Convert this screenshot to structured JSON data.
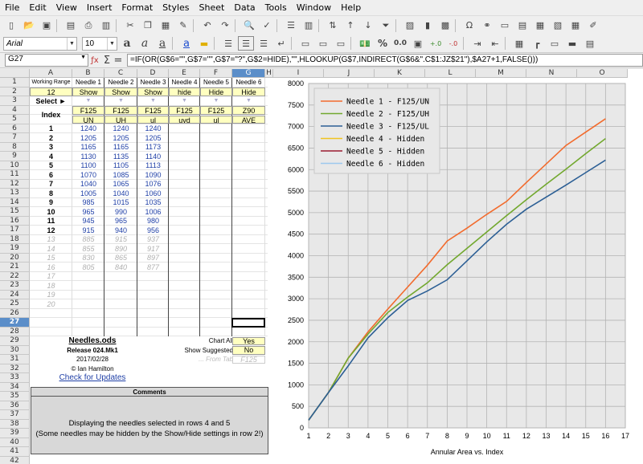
{
  "menu": [
    "File",
    "Edit",
    "View",
    "Insert",
    "Format",
    "Styles",
    "Sheet",
    "Data",
    "Tools",
    "Window",
    "Help"
  ],
  "font_name": "Arial",
  "font_size": "10",
  "namebox": "G27",
  "formula": "=IF(OR(G$6=\"\",G$7=\"\",G$7=\"?\",G$2=HIDE),\"\",HLOOKUP(G$7,INDIRECT(G$6&\".C$1:JZ$21\"),$A27+1,FALSE()))",
  "columns": [
    "A",
    "B",
    "C",
    "D",
    "E",
    "F",
    "G",
    "H",
    "I",
    "J",
    "K",
    "L",
    "M",
    "N",
    "O"
  ],
  "rows": [
    "1",
    "2",
    "3",
    "4",
    "5",
    "6",
    "7",
    "8",
    "9",
    "10",
    "11",
    "12",
    "13",
    "14",
    "15",
    "16",
    "17",
    "18",
    "19",
    "20",
    "21",
    "22",
    "23",
    "24",
    "25",
    "26",
    "27",
    "28",
    "29",
    "30",
    "31",
    "32",
    "33",
    "34",
    "35",
    "36",
    "37",
    "38",
    "39",
    "40",
    "41",
    "42"
  ],
  "sheet": {
    "a1": "Working Range",
    "a2": "12",
    "a3": "Select ►",
    "a4": "Index",
    "needle_headers": [
      "Needle 1",
      "Needle 2",
      "Needle 3",
      "Needle 4",
      "Needle 5",
      "Needle 6"
    ],
    "showhide": [
      "Show",
      "Show",
      "Show",
      "hide",
      "Hide",
      "Hide"
    ],
    "arrow": "▼",
    "row4": [
      "F125",
      "F125",
      "F125",
      "F125",
      "F125",
      "Z90"
    ],
    "row5": [
      "UN",
      "UH",
      "ul",
      "uyd",
      "ul",
      "AVE"
    ],
    "index": [
      "1",
      "2",
      "3",
      "4",
      "5",
      "6",
      "7",
      "8",
      "9",
      "10",
      "11",
      "12",
      "13",
      "14",
      "15",
      "16",
      "17",
      "18",
      "19",
      "20"
    ],
    "col_b": [
      "1240",
      "1205",
      "1165",
      "1130",
      "1100",
      "1070",
      "1040",
      "1005",
      "985",
      "965",
      "945",
      "915",
      "885",
      "855",
      "830",
      "805"
    ],
    "col_c": [
      "1240",
      "1205",
      "1165",
      "1135",
      "1105",
      "1085",
      "1065",
      "1040",
      "1015",
      "990",
      "965",
      "940",
      "915",
      "890",
      "865",
      "840"
    ],
    "col_d": [
      "1240",
      "1205",
      "1173",
      "1140",
      "1113",
      "1090",
      "1076",
      "1060",
      "1035",
      "1006",
      "980",
      "956",
      "937",
      "917",
      "897",
      "877"
    ],
    "title": "Needles.ods",
    "release": "Release 024.Mk1",
    "date": "2017/02/28",
    "author": "© Ian Hamilton",
    "update_link": "Check for Updates",
    "chart_all_label": "Chart All",
    "chart_all": "Yes",
    "show_sugg_label": "Show Suggested",
    "show_sugg": "No",
    "from_tab_label": "... From Tab",
    "from_tab": "F125",
    "comments_title": "Comments",
    "comment1": "Displaying the needles selected in rows 4 and 5",
    "comment2": "(Some needles may be hidden by the Show/Hide settings in row 2!)"
  },
  "chart_data": {
    "type": "line",
    "x": [
      1,
      2,
      3,
      4,
      5,
      6,
      7,
      8,
      9,
      10,
      11,
      12,
      13,
      14,
      15,
      16
    ],
    "xlabel": "Annular Area vs. Index",
    "ylabel": "",
    "xlim": [
      1,
      17
    ],
    "ylim": [
      0,
      8000
    ],
    "xticks": [
      "1",
      "2",
      "3",
      "4",
      "5",
      "6",
      "7",
      "8",
      "9",
      "10",
      "11",
      "12",
      "13",
      "14",
      "15",
      "16",
      "17"
    ],
    "yticks": [
      "0",
      "500",
      "1000",
      "1500",
      "2000",
      "2500",
      "3000",
      "3500",
      "4000",
      "4500",
      "5000",
      "5500",
      "6000",
      "6500",
      "7000",
      "7500",
      "8000"
    ],
    "grid": true,
    "legend_position": "top-left",
    "series": [
      {
        "name": "Needle 1 - F125/UN",
        "color": "#f26b2d",
        "values": [
          180,
          820,
          1620,
          2230,
          2760,
          3270,
          3780,
          4340,
          4640,
          4960,
          5260,
          5700,
          6130,
          6560,
          6870,
          7180
        ]
      },
      {
        "name": "Needle 2 - F125/UH",
        "color": "#72a82e",
        "values": [
          180,
          820,
          1620,
          2180,
          2680,
          3040,
          3370,
          3790,
          4170,
          4550,
          4930,
          5300,
          5660,
          6010,
          6370,
          6720
        ]
      },
      {
        "name": "Needle 3 - F125/UL",
        "color": "#2c5f95",
        "values": [
          180,
          820,
          1440,
          2090,
          2560,
          2960,
          3180,
          3440,
          3880,
          4320,
          4730,
          5080,
          5360,
          5640,
          5930,
          6220
        ]
      },
      {
        "name": "Needle 4 - Hidden",
        "color": "#f0c420",
        "values": []
      },
      {
        "name": "Needle 5 - Hidden",
        "color": "#9b1b30",
        "values": []
      },
      {
        "name": "Needle 6 - Hidden",
        "color": "#9cc8ee",
        "values": []
      }
    ]
  }
}
